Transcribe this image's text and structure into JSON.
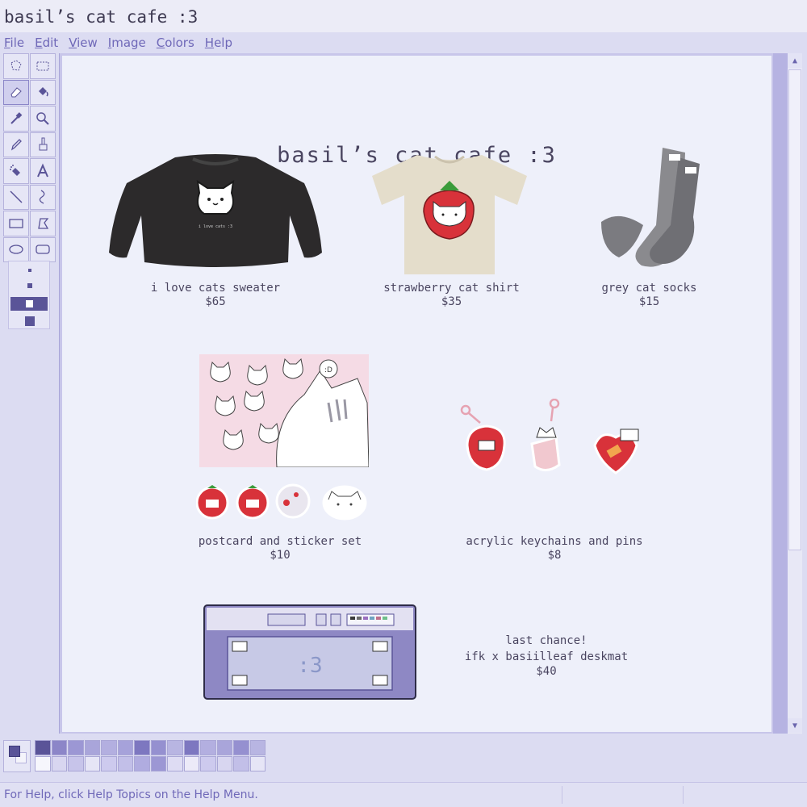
{
  "window": {
    "title": "basil’s cat cafe :3"
  },
  "menu": [
    "File",
    "Edit",
    "View",
    "Image",
    "Colors",
    "Help"
  ],
  "tools": [
    "free-select",
    "rect-select",
    "eraser",
    "fill-bucket",
    "color-picker",
    "magnifier",
    "pencil",
    "brush",
    "airbrush",
    "text",
    "line",
    "curve",
    "rectangle",
    "polygon",
    "ellipse",
    "rounded-rectangle"
  ],
  "page": {
    "title": "basil’s cat cafe :3"
  },
  "products": [
    {
      "name": "i love cats sweater",
      "price": "$65",
      "print": "i love cats :3"
    },
    {
      "name": "strawberry cat shirt",
      "price": "$35"
    },
    {
      "name": "grey cat socks",
      "price": "$15"
    },
    {
      "name": "postcard and sticker set",
      "price": "$10",
      "bubble": ":D"
    },
    {
      "name": "acrylic keychains and pins",
      "price": "$8"
    },
    {
      "name": "ifk x basiilleaf deskmat",
      "price": "$40",
      "note": "last chance!",
      "mat_text": ":3"
    }
  ],
  "palette": {
    "foreground": "#5a5498",
    "background": "#f4f4fb",
    "swatches": [
      "#5a5498",
      "#8c86c8",
      "#9c97d4",
      "#a9a5da",
      "#b3afe0",
      "#a6a2da",
      "#7d77c0",
      "#9590d0",
      "#b8b5e2",
      "#7d77c0",
      "#b3afe0",
      "#a9a5da",
      "#9590d0",
      "#b8b5e2",
      "#f6f6fc",
      "#d8d6f0",
      "#c7c4ea",
      "#e6e5f6",
      "#cdcaee",
      "#c2bfe8",
      "#b0ace0",
      "#9c97d4",
      "#dedcf3",
      "#eceaf8",
      "#cdcaee",
      "#d8d6f0",
      "#c2bfe8",
      "#e6e5f6"
    ]
  },
  "status": {
    "message": "For Help, click Help Topics on the Help Menu."
  },
  "colors": {
    "accent": "#5a5498",
    "canvas": "#eef0fa",
    "chrome": "#dcdcf2",
    "text": "#4a4560"
  }
}
